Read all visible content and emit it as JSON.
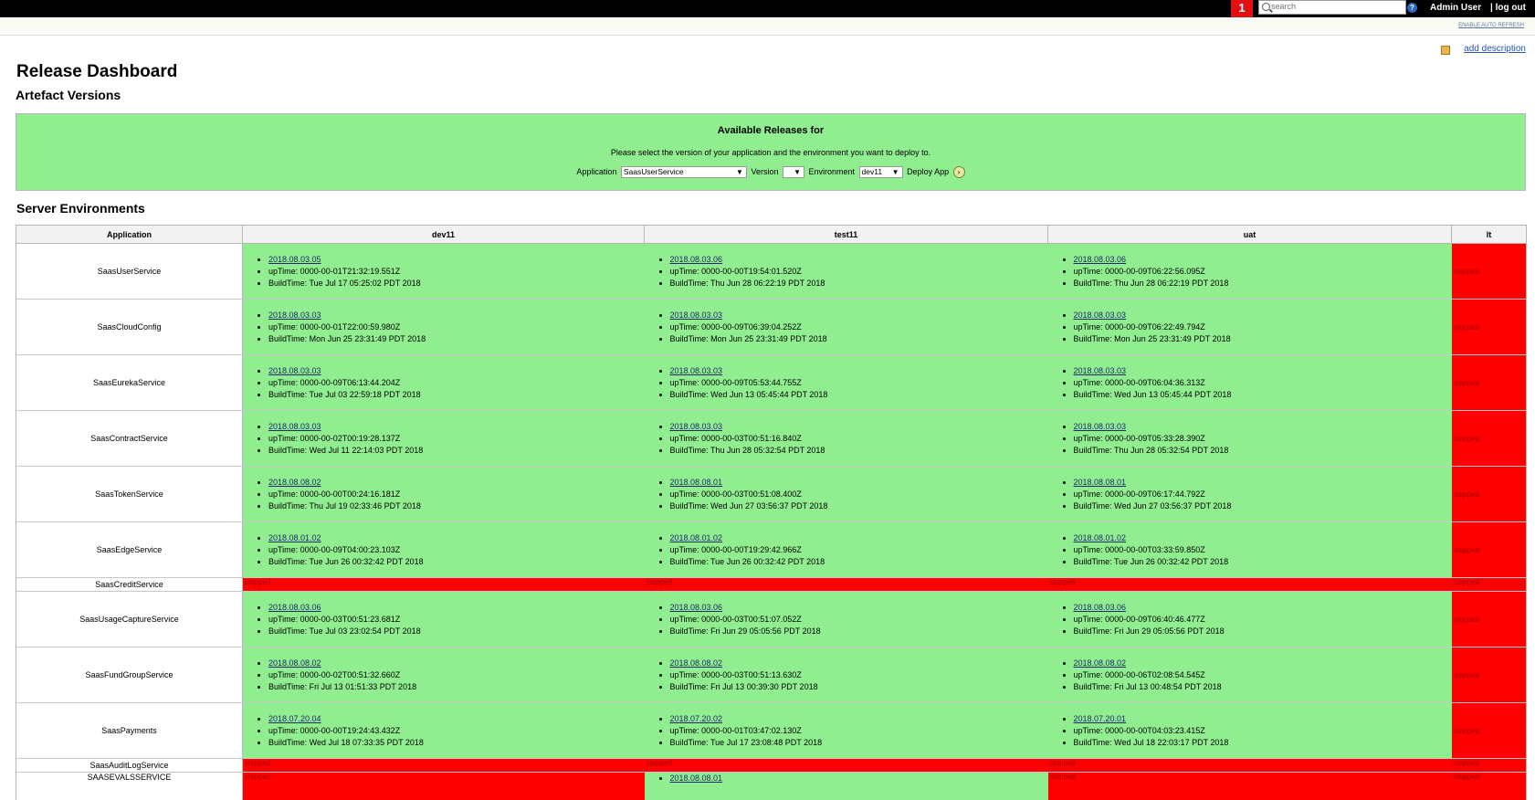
{
  "header": {
    "notification_count": "1",
    "search_placeholder": "search",
    "user_name": "Admin User",
    "logout_label": "| log out",
    "auto_refresh_label": "ENABLE AUTO REFRESH",
    "add_description_label": "add description"
  },
  "page": {
    "title": "Release Dashboard",
    "subtitle": "Artefact Versions"
  },
  "release_panel": {
    "title": "Available Releases for",
    "description": "Please select the version of your application and the environment you want to deploy to.",
    "application_label": "Application",
    "application_value": "SaasUserService",
    "version_label": "Version",
    "version_value": "",
    "environment_label": "Environment",
    "environment_value": "dev11",
    "deploy_label": "Deploy App"
  },
  "environments": {
    "title": "Server Environments",
    "columns": [
      "Application",
      "dev11",
      "test11",
      "uat",
      "lt"
    ],
    "stopped_label": "stopped",
    "rows": [
      {
        "app": "SaasUserService",
        "dev11": {
          "version": "2018.08.03.05",
          "uptime": "upTime: 0000-00-01T21:32:19.551Z",
          "build": "BuildTime: Tue Jul 17 05:25:02 PDT 2018"
        },
        "test11": {
          "version": "2018.08.03.06",
          "uptime": "upTime: 0000-00-00T19:54:01.520Z",
          "build": "BuildTime: Thu Jun 28 06:22:19 PDT 2018"
        },
        "uat": {
          "version": "2018.08.03.06",
          "uptime": "upTime: 0000-00-09T06:22:56.095Z",
          "build": "BuildTime: Thu Jun 28 06:22:19 PDT 2018"
        }
      },
      {
        "app": "SaasCloudConfig",
        "dev11": {
          "version": "2018.08.03.03",
          "uptime": "upTime: 0000-00-01T22:00:59.980Z",
          "build": "BuildTime: Mon Jun 25 23:31:49 PDT 2018"
        },
        "test11": {
          "version": "2018.08.03.03",
          "uptime": "upTime: 0000-00-09T06:39:04.252Z",
          "build": "BuildTime: Mon Jun 25 23:31:49 PDT 2018"
        },
        "uat": {
          "version": "2018.08.03.03",
          "uptime": "upTime: 0000-00-09T06:22:49.794Z",
          "build": "BuildTime: Mon Jun 25 23:31:49 PDT 2018"
        }
      },
      {
        "app": "SaasEurekaService",
        "dev11": {
          "version": "2018.08.03.03",
          "uptime": "upTime: 0000-00-09T06:13:44.204Z",
          "build": "BuildTime: Tue Jul 03 22:59:18 PDT 2018"
        },
        "test11": {
          "version": "2018.08.03.03",
          "uptime": "upTime: 0000-00-09T05:53:44.755Z",
          "build": "BuildTime: Wed Jun 13 05:45:44 PDT 2018"
        },
        "uat": {
          "version": "2018.08.03.03",
          "uptime": "upTime: 0000-00-09T06:04:36.313Z",
          "build": "BuildTime: Wed Jun 13 05:45:44 PDT 2018"
        }
      },
      {
        "app": "SaasContractService",
        "dev11": {
          "version": "2018.08.03.03",
          "uptime": "upTime: 0000-00-02T00:19:28.137Z",
          "build": "BuildTime: Wed Jul 11 22:14:03 PDT 2018"
        },
        "test11": {
          "version": "2018.08.03.03",
          "uptime": "upTime: 0000-00-03T00:51:16.840Z",
          "build": "BuildTime: Thu Jun 28 05:32:54 PDT 2018"
        },
        "uat": {
          "version": "2018.08.03.03",
          "uptime": "upTime: 0000-00-09T05:33:28.390Z",
          "build": "BuildTime: Thu Jun 28 05:32:54 PDT 2018"
        }
      },
      {
        "app": "SaasTokenService",
        "dev11": {
          "version": "2018.08.08.02",
          "uptime": "upTime: 0000-00-00T00:24:16.181Z",
          "build": "BuildTime: Thu Jul 19 02:33:46 PDT 2018"
        },
        "test11": {
          "version": "2018.08.08.01",
          "uptime": "upTime: 0000-00-03T00:51:08.400Z",
          "build": "BuildTime: Wed Jun 27 03:56:37 PDT 2018"
        },
        "uat": {
          "version": "2018.08.08.01",
          "uptime": "upTime: 0000-00-09T06:17:44.792Z",
          "build": "BuildTime: Wed Jun 27 03:56:37 PDT 2018"
        }
      },
      {
        "app": "SaasEdgeService",
        "dev11": {
          "version": "2018.08.01.02",
          "uptime": "upTime: 0000-00-09T04:00:23.103Z",
          "build": "BuildTime: Tue Jun 26 00:32:42 PDT 2018"
        },
        "test11": {
          "version": "2018.08.01.02",
          "uptime": "upTime: 0000-00-00T19:29:42.966Z",
          "build": "BuildTime: Tue Jun 26 00:32:42 PDT 2018"
        },
        "uat": {
          "version": "2018.08.01.02",
          "uptime": "upTime: 0000-00-00T03:33:59.850Z",
          "build": "BuildTime: Tue Jun 26 00:32:42 PDT 2018"
        }
      },
      {
        "app": "SaasCreditService"
      },
      {
        "app": "SaasUsageCaptureService",
        "dev11": {
          "version": "2018.08.03.06",
          "uptime": "upTime: 0000-00-03T00:51:23.681Z",
          "build": "BuildTime: Tue Jul 03 23:02:54 PDT 2018"
        },
        "test11": {
          "version": "2018.08.03.06",
          "uptime": "upTime: 0000-00-03T00:51:07.052Z",
          "build": "BuildTime: Fri Jun 29 05:05:56 PDT 2018"
        },
        "uat": {
          "version": "2018.08.03.06",
          "uptime": "upTime: 0000-00-09T06:40:46.477Z",
          "build": "BuildTime: Fri Jun 29 05:05:56 PDT 2018"
        }
      },
      {
        "app": "SaasFundGroupService",
        "dev11": {
          "version": "2018.08.08.02",
          "uptime": "upTime: 0000-00-02T00:51:32.660Z",
          "build": "BuildTime: Fri Jul 13 01:51:33 PDT 2018"
        },
        "test11": {
          "version": "2018.08.08.02",
          "uptime": "upTime: 0000-00-03T00:51:13.630Z",
          "build": "BuildTime: Fri Jul 13 00:39:30 PDT 2018"
        },
        "uat": {
          "version": "2018.08.08.02",
          "uptime": "upTime: 0000-00-06T02:08:54.545Z",
          "build": "BuildTime: Fri Jul 13 00:48:54 PDT 2018"
        }
      },
      {
        "app": "SaasPayments",
        "dev11": {
          "version": "2018.07.20.04",
          "uptime": "upTime: 0000-00-00T19:24:43.432Z",
          "build": "BuildTime: Wed Jul 18 07:33:35 PDT 2018"
        },
        "test11": {
          "version": "2018.07.20.02",
          "uptime": "upTime: 0000-00-01T03:47:02.130Z",
          "build": "BuildTime: Tue Jul 17 23:08:48 PDT 2018"
        },
        "uat": {
          "version": "2018.07.20.01",
          "uptime": "upTime: 0000-00-00T04:03:23.415Z",
          "build": "BuildTime: Wed Jul 18 22:03:17 PDT 2018"
        }
      },
      {
        "app": "SaasAuditLogService"
      },
      {
        "app": "SAASEVALSSERVICE",
        "test11": {
          "version": "2018.08.08.01"
        }
      }
    ]
  }
}
